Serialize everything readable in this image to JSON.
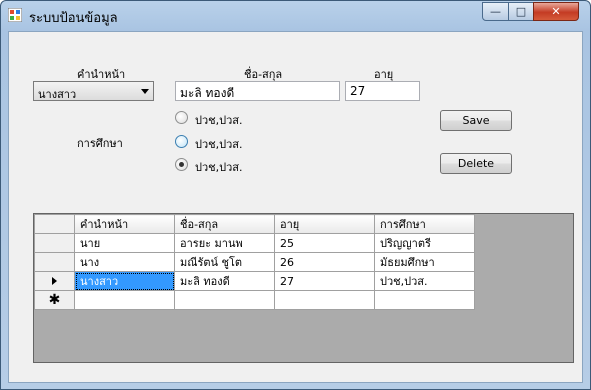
{
  "window": {
    "title": "ระบบป้อนข้อมูล",
    "min_glyph": "—",
    "max_glyph": "□",
    "close_glyph": "✕"
  },
  "form": {
    "prefix_label": "คำนำหน้า",
    "prefix_value": "นางสาว",
    "name_label": "ชื่อ-สกุล",
    "name_value": "มะลิ ทองดี",
    "age_label": "อายุ",
    "age_value": "27",
    "education_label": "การศึกษา",
    "education_options": [
      {
        "label": "ปวช,ปวส.",
        "checked": false
      },
      {
        "label": "ปวช,ปวส.",
        "checked": false
      },
      {
        "label": "ปวช,ปวส.",
        "checked": true
      }
    ],
    "save_label": "Save",
    "delete_label": "Delete"
  },
  "grid": {
    "columns": [
      "คำนำหน้า",
      "ชื่อ-สกุล",
      "อายุ",
      "การศึกษา"
    ],
    "rows": [
      [
        "นาย",
        "อารยะ มานพ",
        "25",
        "ปริญญาตรี"
      ],
      [
        "นาง",
        "มณีรัตน์ ชูโต",
        "26",
        "มัธยมศึกษา"
      ],
      [
        "นางสาว",
        "มะลิ ทองดี",
        "27",
        "ปวช,ปวส."
      ]
    ],
    "selected_row": 2,
    "new_row_marker": "✱"
  },
  "colors": {
    "selection": "#3399ff",
    "grid_background": "#ababab",
    "client_background": "#f0f0f0"
  }
}
